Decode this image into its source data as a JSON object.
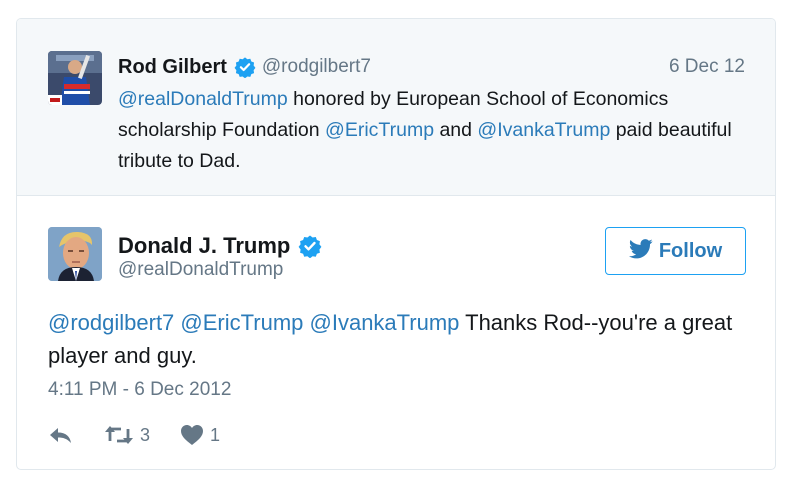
{
  "quoted_tweet": {
    "author_name": "Rod Gilbert",
    "author_handle": "@rodgilbert7",
    "date": "6 Dec 12",
    "text_parts": [
      {
        "text": "@realDonaldTrump",
        "mention": true
      },
      {
        "text": " honored by European School of Economics scholarship Foundation ",
        "mention": false
      },
      {
        "text": "@EricTrump",
        "mention": true
      },
      {
        "text": " and ",
        "mention": false
      },
      {
        "text": "@IvankaTrump",
        "mention": true
      },
      {
        "text": " paid beautiful tribute to Dad.",
        "mention": false
      }
    ]
  },
  "tweet": {
    "author_name": "Donald J. Trump",
    "author_handle": "@realDonaldTrump",
    "follow_label": "Follow",
    "text_parts": [
      {
        "text": "@rodgilbert7",
        "mention": true
      },
      {
        "text": " ",
        "mention": false
      },
      {
        "text": "@EricTrump",
        "mention": true
      },
      {
        "text": " ",
        "mention": false
      },
      {
        "text": "@IvankaTrump",
        "mention": true
      },
      {
        "text": " Thanks Rod--you're a great player and guy.",
        "mention": false
      }
    ],
    "timestamp": "4:11 PM - 6 Dec 2012",
    "retweet_count": "3",
    "like_count": "1"
  },
  "icons": {
    "verified": "verified-badge-icon",
    "twitter_bird": "twitter-bird-icon",
    "reply": "reply-icon",
    "retweet": "retweet-icon",
    "like": "heart-icon"
  },
  "colors": {
    "mention": "#2b7bb9",
    "verified": "#1da1f2",
    "muted": "#657786",
    "quoted_bg": "#f5f8fa",
    "border": "#e1e8ed"
  }
}
